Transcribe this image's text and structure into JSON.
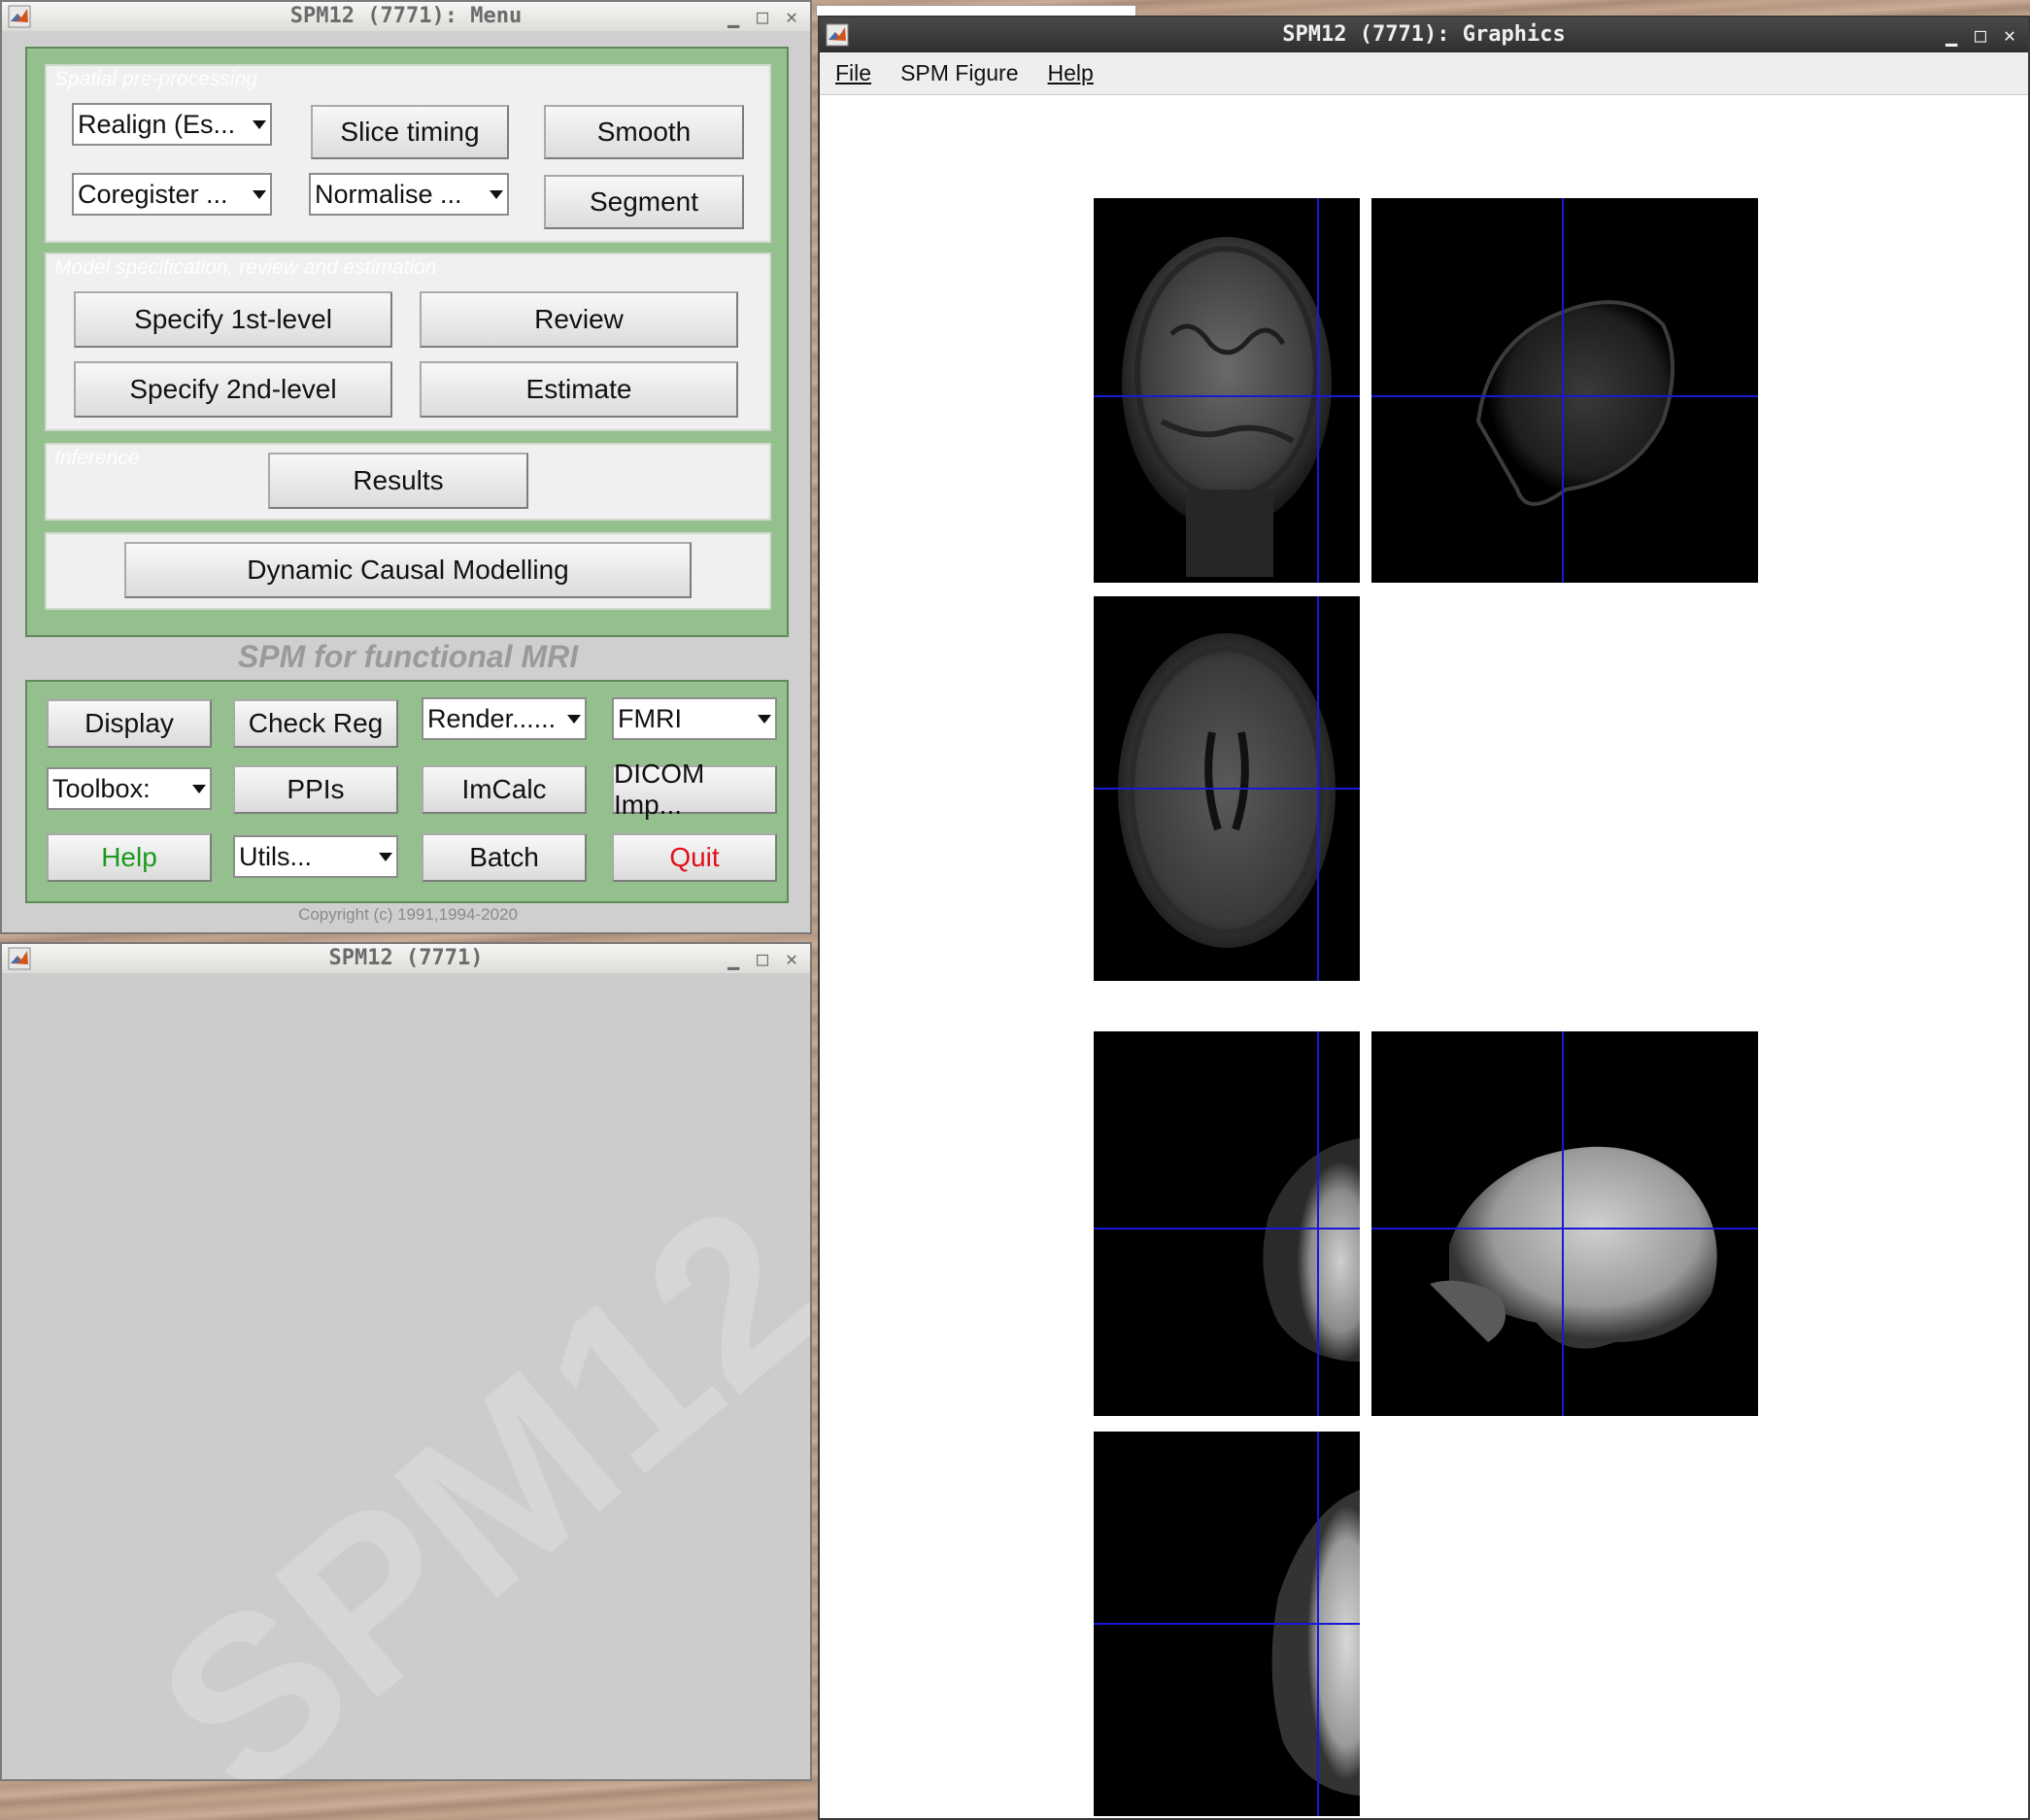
{
  "menu_window": {
    "title": "SPM12 (7771): Menu",
    "spatial": {
      "label": "Spatial pre-processing",
      "realign": "Realign (Es...",
      "slice_timing": "Slice timing",
      "smooth": "Smooth",
      "coregister": "Coregister ...",
      "normalise": "Normalise ...",
      "segment": "Segment"
    },
    "model": {
      "label": "Model specification, review and estimation",
      "specify_1st": "Specify 1st-level",
      "review": "Review",
      "specify_2nd": "Specify 2nd-level",
      "estimate": "Estimate"
    },
    "inference": {
      "label": "Inference",
      "results": "Results"
    },
    "dcm": "Dynamic Causal Modelling",
    "subtitle": "SPM for functional MRI",
    "tools": {
      "display": "Display",
      "check_reg": "Check Reg",
      "render": "Render......",
      "modality": "FMRI",
      "toolbox": "Toolbox:",
      "ppis": "PPIs",
      "imcalc": "ImCalc",
      "dicom": "DICOM Imp...",
      "help": "Help",
      "utils": "Utils...",
      "batch": "Batch",
      "quit": "Quit"
    },
    "copyright": "Copyright (c) 1991,1994-2020"
  },
  "interactive_window": {
    "title": "SPM12 (7771)",
    "watermark": "SPM12"
  },
  "graphics_window": {
    "title": "SPM12 (7771): Graphics",
    "menu": {
      "file": "File",
      "spm_figure": "SPM Figure",
      "help": "Help"
    }
  },
  "colors": {
    "panel_green": "#94c08e",
    "help_text": "#1a9a1a",
    "quit_text": "#e0101a",
    "crosshair": "#1818d8"
  }
}
